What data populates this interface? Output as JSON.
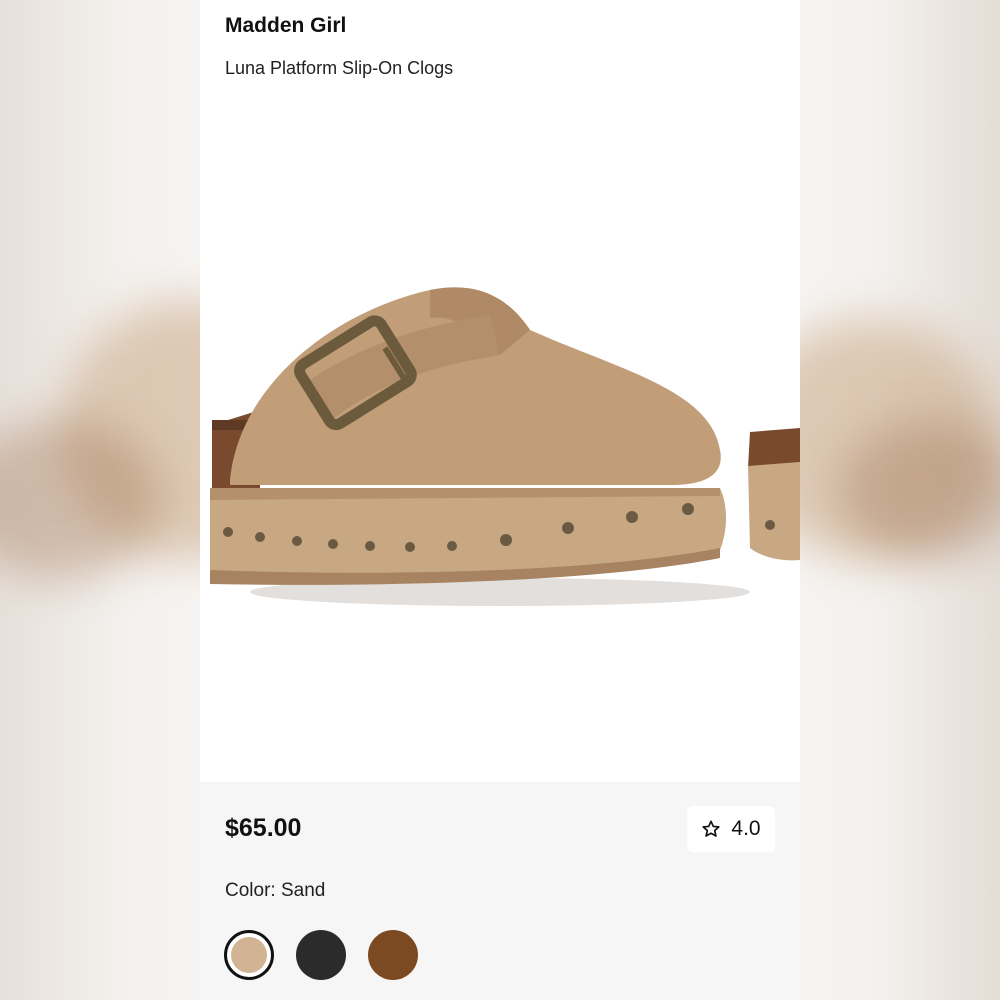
{
  "product": {
    "brand": "Madden Girl",
    "name": "Luna Platform Slip-On Clogs",
    "price": "$65.00",
    "rating": "4.0",
    "color_label": "Color: Sand"
  },
  "icons": {
    "rating": "star-outline-icon"
  },
  "swatches": [
    {
      "name": "Sand",
      "color": "#d2b393",
      "selected": true
    },
    {
      "name": "Black",
      "color": "#2b2b2b",
      "selected": false
    },
    {
      "name": "Brown",
      "color": "#7c4a22",
      "selected": false
    }
  ],
  "colors": {
    "suede": "#c19d78",
    "cork": "#7a4a2e",
    "stud": "#6a5a44"
  }
}
